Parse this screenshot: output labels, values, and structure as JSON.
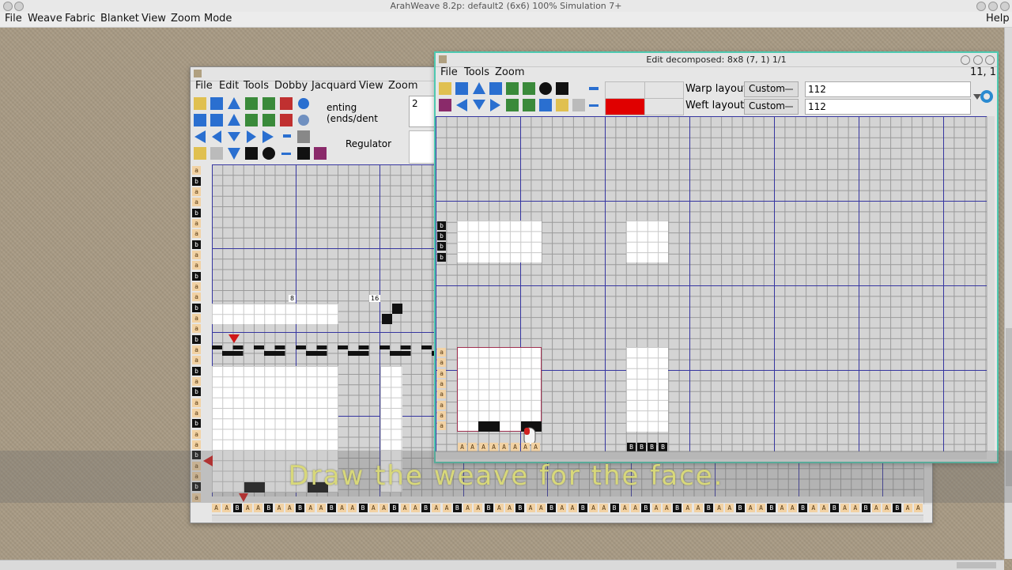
{
  "app": {
    "title": "ArahWeave 8.2p: default2 (6x6) 100% Simulation 7+",
    "menu": [
      "File",
      "Weave",
      "Fabric",
      "Blanket",
      "View",
      "Zoom",
      "Mode"
    ],
    "help": "Help"
  },
  "weave_window": {
    "menu": [
      "File",
      "Edit",
      "Tools",
      "Dobby",
      "Jacquard",
      "View",
      "Zoom"
    ],
    "denting_label": "Denting (ends/dent)",
    "denting_label_visible": "enting (ends/dent",
    "denting_value": "2",
    "regulator_label": "Regulator",
    "ruler_labels": [
      "8",
      "16"
    ],
    "left_labels": [
      "a",
      "b",
      "a",
      "a",
      "b",
      "a",
      "a",
      "b",
      "a",
      "a",
      "b",
      "a",
      "a",
      "b",
      "a",
      "a",
      "b",
      "a",
      "a",
      "b",
      "a",
      "b",
      "a",
      "a",
      "b",
      "a",
      "a",
      "b",
      "a",
      "a",
      "b",
      "a"
    ],
    "bottom_labels": [
      "A",
      "A",
      "B",
      "A",
      "A",
      "B",
      "A",
      "A",
      "B",
      "A",
      "A",
      "B",
      "A",
      "A",
      "B",
      "A",
      "A",
      "B",
      "A",
      "A",
      "B",
      "A",
      "A",
      "B",
      "A",
      "A",
      "B",
      "A",
      "A",
      "B",
      "A",
      "A",
      "B",
      "A",
      "A",
      "B",
      "A",
      "A",
      "B",
      "A",
      "A",
      "B",
      "A",
      "A",
      "B",
      "A",
      "A",
      "B",
      "A",
      "A",
      "B",
      "A",
      "A",
      "B",
      "A",
      "A",
      "B",
      "A",
      "A",
      "B",
      "A",
      "A",
      "B",
      "A",
      "A",
      "B",
      "A",
      "A",
      "B",
      "A"
    ]
  },
  "decomposed_window": {
    "title": "Edit decomposed:  8x8 (7, 1) 1/1",
    "menu": [
      "File",
      "Tools",
      "Zoom"
    ],
    "coords": "11, 1",
    "warp_layout_label": "Warp layout",
    "warp_layout_value": "Custom",
    "warp_layout_field": "112",
    "weft_layout_label": "Weft layout",
    "weft_layout_value": "Custom",
    "weft_layout_field": "112",
    "selected_color": "#e00000",
    "left_labels_top": [
      "b",
      "b",
      "b",
      "b"
    ],
    "left_labels_bottom": [
      "a",
      "a",
      "a",
      "a",
      "a",
      "a",
      "a",
      "a"
    ],
    "bottom_labels_a": [
      "A",
      "A",
      "A",
      "A",
      "A",
      "A",
      "A",
      "A"
    ],
    "bottom_labels_b": [
      "B",
      "B",
      "B",
      "B"
    ]
  },
  "subtitle": "Draw the weave for the face."
}
